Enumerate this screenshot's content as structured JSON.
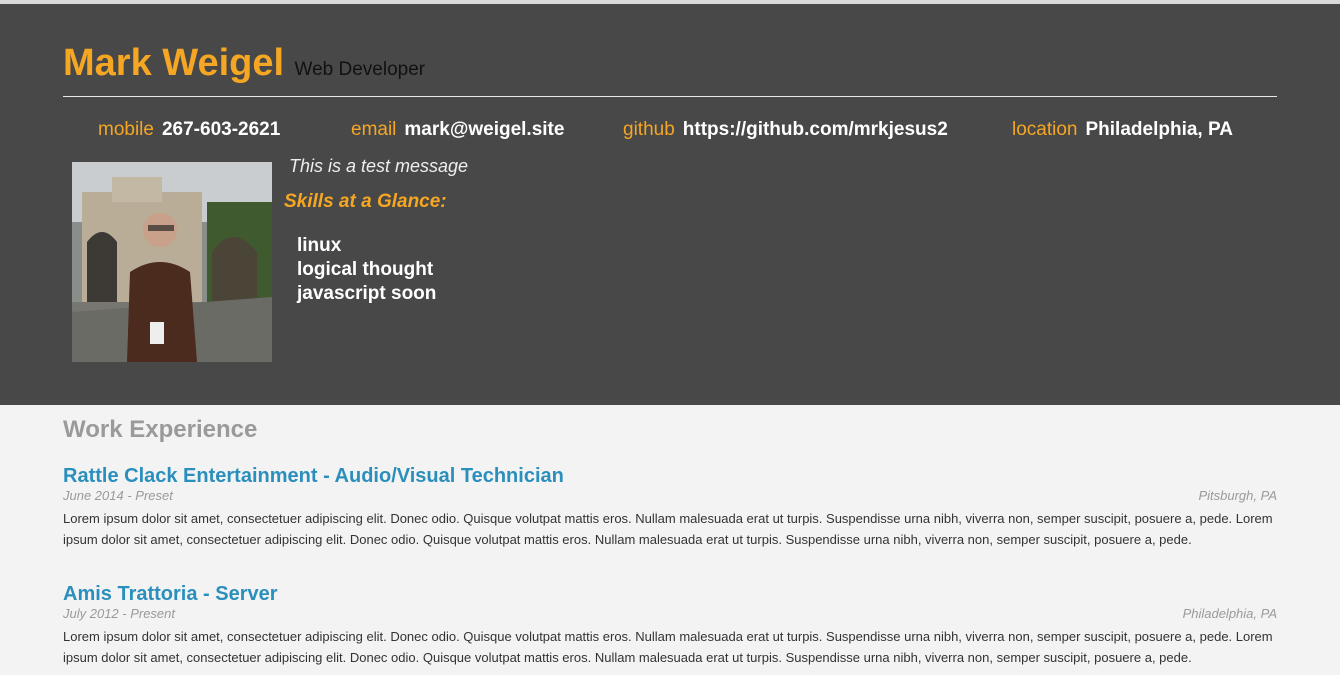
{
  "header": {
    "name": "Mark Weigel",
    "role": "Web Developer",
    "contacts": [
      {
        "label": "mobile",
        "value": "267-603-2621"
      },
      {
        "label": "email",
        "value": "mark@weigel.site"
      },
      {
        "label": "github",
        "value": "https://github.com/mrkjesus2"
      },
      {
        "label": "location",
        "value": "Philadelphia, PA"
      }
    ],
    "tagline": "This is a test message",
    "skills_title": "Skills at a Glance:",
    "skills": [
      "linux",
      "logical thought",
      "javascript soon"
    ]
  },
  "work": {
    "title": "Work Experience",
    "jobs": [
      {
        "title": "Rattle Clack Entertainment - Audio/Visual Technician",
        "dates": "June 2014 - Preset",
        "location": "Pitsburgh, PA",
        "description": "Lorem ipsum dolor sit amet, consectetuer adipiscing elit. Donec odio. Quisque volutpat mattis eros. Nullam malesuada erat ut turpis. Suspendisse urna nibh, viverra non, semper suscipit, posuere a, pede. Lorem ipsum dolor sit amet, consectetuer adipiscing elit. Donec odio. Quisque volutpat mattis eros. Nullam malesuada erat ut turpis. Suspendisse urna nibh, viverra non, semper suscipit, posuere a, pede."
      },
      {
        "title": "Amis Trattoria - Server",
        "dates": "July 2012 - Present",
        "location": "Philadelphia, PA",
        "description": "Lorem ipsum dolor sit amet, consectetuer adipiscing elit. Donec odio. Quisque volutpat mattis eros. Nullam malesuada erat ut turpis. Suspendisse urna nibh, viverra non, semper suscipit, posuere a, pede. Lorem ipsum dolor sit amet, consectetuer adipiscing elit. Donec odio. Quisque volutpat mattis eros. Nullam malesuada erat ut turpis. Suspendisse urna nibh, viverra non, semper suscipit, posuere a, pede."
      }
    ]
  },
  "colors": {
    "accent": "#f5a623",
    "header_bg": "#484848",
    "link": "#2b8fbd",
    "page_bg": "#f3f3f3"
  }
}
